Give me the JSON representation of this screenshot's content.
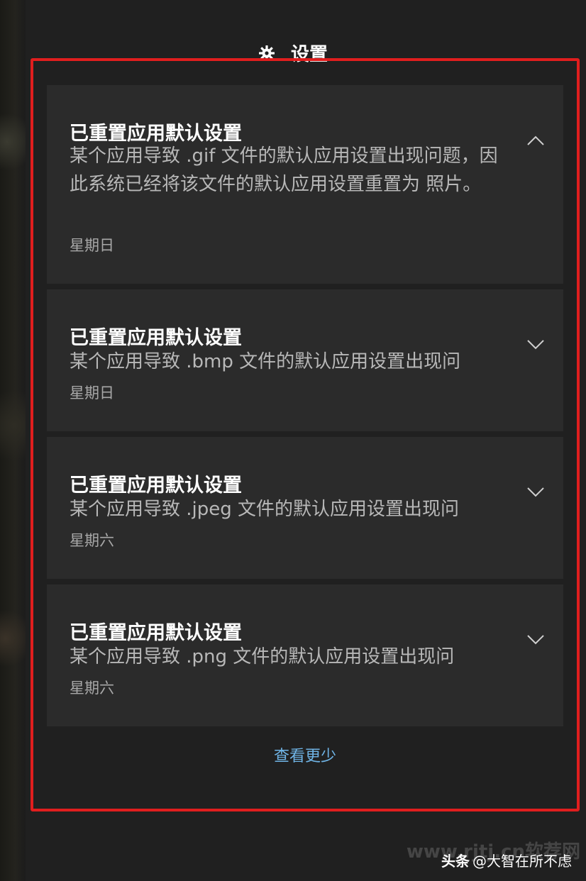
{
  "header": {
    "title": "设置",
    "icon": "gear-icon"
  },
  "notifications": [
    {
      "title": "已重置应用默认设置",
      "body": "某个应用导致 .gif 文件的默认应用设置出现问题，因此系统已经将该文件的默认应用设置重置为 照片。",
      "date": "星期日",
      "expanded": true,
      "chevron": "chevron-up-icon"
    },
    {
      "title": "已重置应用默认设置",
      "body": "某个应用导致 .bmp 文件的默认应用设置出现问",
      "date": "星期日",
      "expanded": false,
      "chevron": "chevron-down-icon"
    },
    {
      "title": "已重置应用默认设置",
      "body": "某个应用导致 .jpeg 文件的默认应用设置出现问",
      "date": "星期六",
      "expanded": false,
      "chevron": "chevron-down-icon"
    },
    {
      "title": "已重置应用默认设置",
      "body": "某个应用导致 .png 文件的默认应用设置出现问",
      "date": "星期六",
      "expanded": false,
      "chevron": "chevron-down-icon"
    }
  ],
  "footer": {
    "see_less": "查看更少"
  },
  "overlay": {
    "watermark": "www.rjtj.cn软荐网",
    "credit_brand": "头条",
    "credit_author": "@大智在所不虑"
  },
  "colors": {
    "highlight_border": "#e01e1e",
    "link": "#6fb4e6",
    "card_bg": "#2b2b2b",
    "panel_bg": "#202020"
  }
}
